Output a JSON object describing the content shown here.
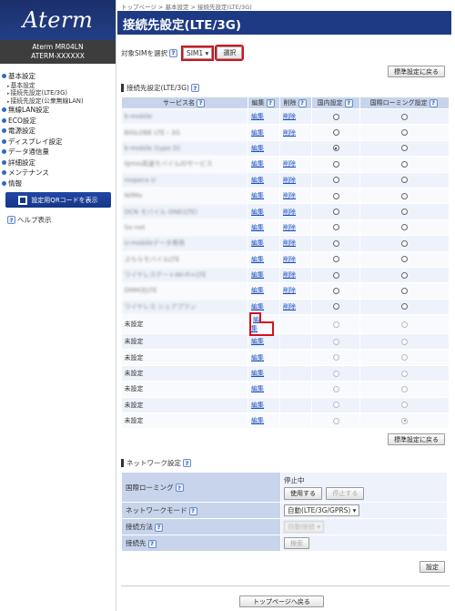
{
  "brand": {
    "logo": "Aterm",
    "model": "Aterm MR04LN",
    "device_id": "ATERM-XXXXXX"
  },
  "sidebar": {
    "menu": [
      {
        "label": "基本設定",
        "children": [
          "基本設定",
          "接続先設定(LTE/3G)",
          "接続先設定(公衆無線LAN)"
        ]
      },
      {
        "label": "無線LAN設定"
      },
      {
        "label": "ECO設定"
      },
      {
        "label": "電源設定"
      },
      {
        "label": "ディスプレイ設定"
      },
      {
        "label": "データ通信量"
      },
      {
        "label": "詳細設定"
      },
      {
        "label": "メンテナンス"
      },
      {
        "label": "情報"
      }
    ],
    "qr_button": "設定用QRコードを表示",
    "help": "ヘルプ表示",
    "help_icon": "?"
  },
  "breadcrumb": "トップページ > 基本設定 > 接続先設定(LTE/3G)",
  "page_title": "接続先設定(LTE/3G)",
  "sim": {
    "label": "対象SIMを選択",
    "selected": "SIM1 ▾",
    "select_button": "選択"
  },
  "restore_button": "標準設定に戻る",
  "apn_section": {
    "title": "接続先設定(LTE/3G)",
    "headers": {
      "service": "サービス名",
      "edit": "編集",
      "delete": "削除",
      "domestic": "国内設定",
      "roaming": "国際ローミング設定"
    },
    "rows": [
      {
        "name": "b-mobile",
        "blurred": true,
        "edit": "編集",
        "del": "削除",
        "dom": false,
        "roam": false,
        "disabled": false
      },
      {
        "name": "BIGLOBE LTE・3G",
        "blurred": true,
        "edit": "編集",
        "del": "削除",
        "dom": false,
        "roam": false,
        "disabled": false
      },
      {
        "name": "b-mobile (type D)",
        "blurred": true,
        "edit": "編集",
        "del": "",
        "dom": true,
        "roam": false,
        "disabled": false
      },
      {
        "name": "IIJmio高速モバイル/Dサービス",
        "blurred": true,
        "edit": "編集",
        "del": "削除",
        "dom": false,
        "roam": false,
        "disabled": false
      },
      {
        "name": "mopera U",
        "blurred": true,
        "edit": "編集",
        "del": "削除",
        "dom": false,
        "roam": false,
        "disabled": false
      },
      {
        "name": "NifMo",
        "blurred": true,
        "edit": "編集",
        "del": "削除",
        "dom": false,
        "roam": false,
        "disabled": false
      },
      {
        "name": "OCN モバイル ONE(LTE)",
        "blurred": true,
        "edit": "編集",
        "del": "削除",
        "dom": false,
        "roam": false,
        "disabled": false
      },
      {
        "name": "So-net",
        "blurred": true,
        "edit": "編集",
        "del": "削除",
        "dom": false,
        "roam": false,
        "disabled": false
      },
      {
        "name": "U-mobileデータ専用",
        "blurred": true,
        "edit": "編集",
        "del": "削除",
        "dom": false,
        "roam": false,
        "disabled": false
      },
      {
        "name": "ぷららモバイルLTE",
        "blurred": true,
        "edit": "編集",
        "del": "削除",
        "dom": false,
        "roam": false,
        "disabled": false
      },
      {
        "name": "ワイヤレスゲートWi-Fi+LTE",
        "blurred": true,
        "edit": "編集",
        "del": "削除",
        "dom": false,
        "roam": false,
        "disabled": false
      },
      {
        "name": "DMM光LTE",
        "blurred": true,
        "edit": "編集",
        "del": "削除",
        "dom": false,
        "roam": false,
        "disabled": false
      },
      {
        "name": "ワイヤレス シェアプラン",
        "blurred": true,
        "edit": "編集",
        "del": "削除",
        "dom": false,
        "roam": false,
        "disabled": false
      },
      {
        "name": "未設定",
        "blurred": false,
        "edit": "編集",
        "del": "",
        "dom": false,
        "roam": false,
        "disabled": true,
        "highlight": true
      },
      {
        "name": "未設定",
        "blurred": false,
        "edit": "編集",
        "del": "",
        "dom": false,
        "roam": false,
        "disabled": true
      },
      {
        "name": "未設定",
        "blurred": false,
        "edit": "編集",
        "del": "",
        "dom": false,
        "roam": false,
        "disabled": true
      },
      {
        "name": "未設定",
        "blurred": false,
        "edit": "編集",
        "del": "",
        "dom": false,
        "roam": false,
        "disabled": true
      },
      {
        "name": "未設定",
        "blurred": false,
        "edit": "編集",
        "del": "",
        "dom": false,
        "roam": false,
        "disabled": true
      },
      {
        "name": "未設定",
        "blurred": false,
        "edit": "編集",
        "del": "",
        "dom": false,
        "roam": false,
        "disabled": true
      },
      {
        "name": "未設定",
        "blurred": false,
        "edit": "編集",
        "del": "",
        "dom": false,
        "roam": true,
        "disabled": true
      }
    ]
  },
  "network": {
    "title": "ネットワーク設定",
    "roaming_label": "国際ローミング",
    "roaming_status": "停止中",
    "use_button": "使用する",
    "stop_button": "停止する",
    "mode_label": "ネットワークモード",
    "mode_value": "自動(LTE/3G/GPRS) ▾",
    "method_label": "接続方法",
    "method_value": "自動接続 ▾",
    "dest_label": "接続先",
    "search_button": "検索",
    "apply_button": "設定"
  },
  "back_button": "トップページへ戻る",
  "colors": {
    "title_bg": "#1e3a84",
    "header_bg": "#c7d4eb",
    "link": "#1a4fbf",
    "highlight": "#d6111c"
  }
}
